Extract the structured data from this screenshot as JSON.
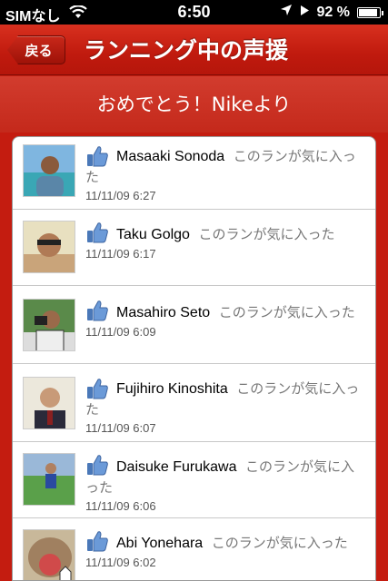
{
  "status_bar": {
    "carrier": "SIMなし",
    "time": "6:50",
    "battery_percent": "92 %",
    "battery_level": 0.92
  },
  "nav": {
    "back_label": "戻る",
    "title": "ランニング中の声援"
  },
  "subheader": "おめでとう！Nikeより",
  "likes": [
    {
      "name": "Masaaki Sonoda",
      "action": "このランが気に入った",
      "time": "11/11/09 6:27"
    },
    {
      "name": "Taku Golgo",
      "action": "このランが気に入った",
      "time": "11/11/09 6:17"
    },
    {
      "name": "Masahiro Seto",
      "action": "このランが気に入った",
      "time": "11/11/09 6:09"
    },
    {
      "name": "Fujihiro Kinoshita",
      "action": "このランが気に入った",
      "time": "11/11/09 6:07"
    },
    {
      "name": "Daisuke Furukawa",
      "action": "このランが気に入った",
      "time": "11/11/09 6:06"
    },
    {
      "name": "Abi Yonehara",
      "action": "このランが気に入った",
      "time": "11/11/09 6:02"
    }
  ],
  "icons": {
    "like": "thumbs-up-icon",
    "wifi": "wifi-icon",
    "location": "location-arrow-icon",
    "play": "play-icon",
    "battery": "battery-icon"
  }
}
